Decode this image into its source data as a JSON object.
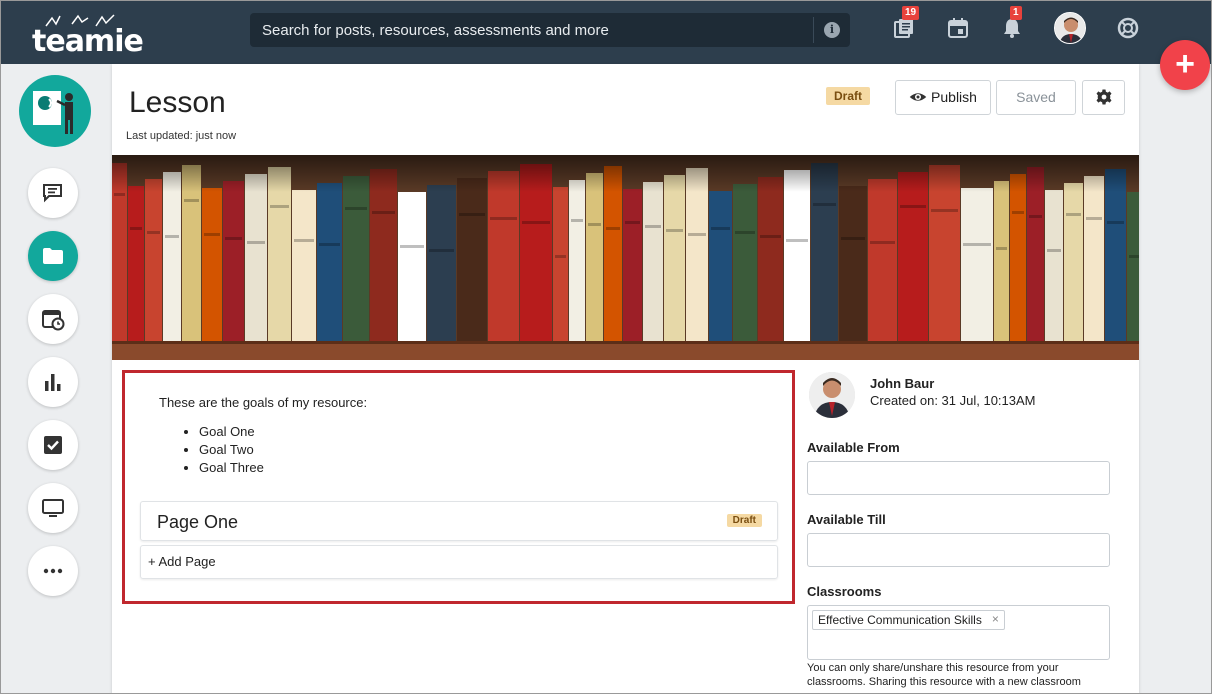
{
  "app": {
    "logo_text": "teamie"
  },
  "topbar": {
    "search_placeholder": "Search for posts, resources, assessments and more",
    "search_info": "i",
    "library_badge": "19",
    "notifications_badge": "1"
  },
  "lesson": {
    "title": "Lesson",
    "last_updated": "Last updated: just now",
    "status": "Draft",
    "publish_label": "Publish",
    "saved_label": "Saved"
  },
  "content": {
    "goals_intro": "These are the goals of my resource:",
    "goals": [
      "Goal One",
      "Goal Two",
      "Goal Three"
    ],
    "pages": [
      {
        "title": "Page One",
        "status": "Draft"
      }
    ],
    "add_page_label": "+ Add Page"
  },
  "author": {
    "name": "John Baur",
    "created": "Created on: 31 Jul, 10:13AM"
  },
  "fields": {
    "available_from_label": "Available From",
    "available_till_label": "Available Till",
    "classrooms_label": "Classrooms",
    "classroom_chip": "Effective Communication Skills",
    "chip_remove": "×",
    "help_text": "You can only share/unshare this resource from your classrooms. Sharing this resource with a new classroom"
  },
  "fab_label": "+",
  "colors": {
    "topbar": "#2d3e4d",
    "accent_teal": "#12a89c",
    "fab_red": "#f1424a",
    "highlight_border": "#c0282e",
    "draft_badge": "#f5d9a3"
  }
}
